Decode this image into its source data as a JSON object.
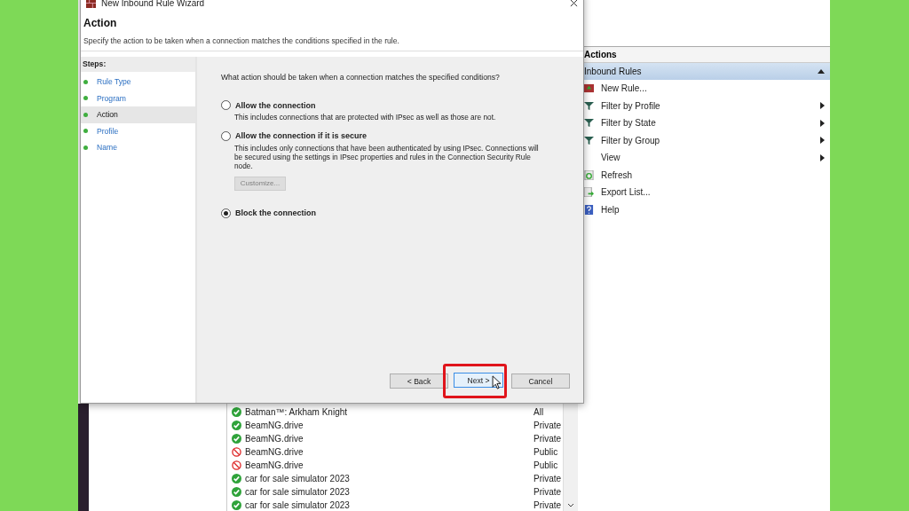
{
  "dialog": {
    "title": "New Inbound Rule Wizard",
    "heading": "Action",
    "subtitle": "Specify the action to be taken when a connection matches the conditions specified in the rule.",
    "steps_label": "Steps:",
    "steps": [
      {
        "label": "Rule Type",
        "selected": false
      },
      {
        "label": "Program",
        "selected": false
      },
      {
        "label": "Action",
        "selected": true
      },
      {
        "label": "Profile",
        "selected": false
      },
      {
        "label": "Name",
        "selected": false
      }
    ],
    "question": "What action should be taken when a connection matches the specified conditions?",
    "options": [
      {
        "label": "Allow the connection",
        "description": "This includes connections that are protected with IPsec as well as those are not.",
        "selected": false
      },
      {
        "label": "Allow the connection if it is secure",
        "description": "This includes only connections that have been authenticated by using IPsec.  Connections will be secured using the settings in IPsec properties and rules in the Connection Security Rule node.",
        "selected": false,
        "button": {
          "label": "Customize...",
          "disabled": true
        }
      },
      {
        "label": "Block the connection",
        "selected": true
      }
    ],
    "buttons": [
      {
        "label": "< Back",
        "highlighted": false
      },
      {
        "label": "Next >",
        "highlighted": true
      },
      {
        "label": "Cancel",
        "highlighted": false
      }
    ]
  },
  "actions_pane": {
    "title": "Actions",
    "section": "Inbound Rules",
    "items": [
      {
        "label": "New Rule...",
        "kind": "new",
        "submenu": false
      },
      {
        "label": "Filter by Profile",
        "kind": "filter",
        "submenu": true
      },
      {
        "label": "Filter by State",
        "kind": "filter",
        "submenu": true
      },
      {
        "label": "Filter by Group",
        "kind": "filter",
        "submenu": true
      },
      {
        "label": "View",
        "kind": "plain",
        "submenu": true
      },
      {
        "label": "Refresh",
        "kind": "refresh",
        "submenu": false
      },
      {
        "label": "Export List...",
        "kind": "export",
        "submenu": false
      },
      {
        "label": "Help",
        "kind": "help",
        "submenu": false
      }
    ]
  },
  "rules": [
    {
      "name": "Batman™: Arkham Knight",
      "profile": "All",
      "kind": "allow"
    },
    {
      "name": "BeamNG.drive",
      "profile": "Private",
      "kind": "allow"
    },
    {
      "name": "BeamNG.drive",
      "profile": "Private",
      "kind": "allow"
    },
    {
      "name": "BeamNG.drive",
      "profile": "Public",
      "kind": "block"
    },
    {
      "name": "BeamNG.drive",
      "profile": "Public",
      "kind": "block"
    },
    {
      "name": "car for sale simulator 2023",
      "profile": "Private",
      "kind": "allow"
    },
    {
      "name": "car for sale simulator 2023",
      "profile": "Private",
      "kind": "allow"
    },
    {
      "name": "car for sale simulator 2023",
      "profile": "Private",
      "kind": "allow"
    }
  ]
}
